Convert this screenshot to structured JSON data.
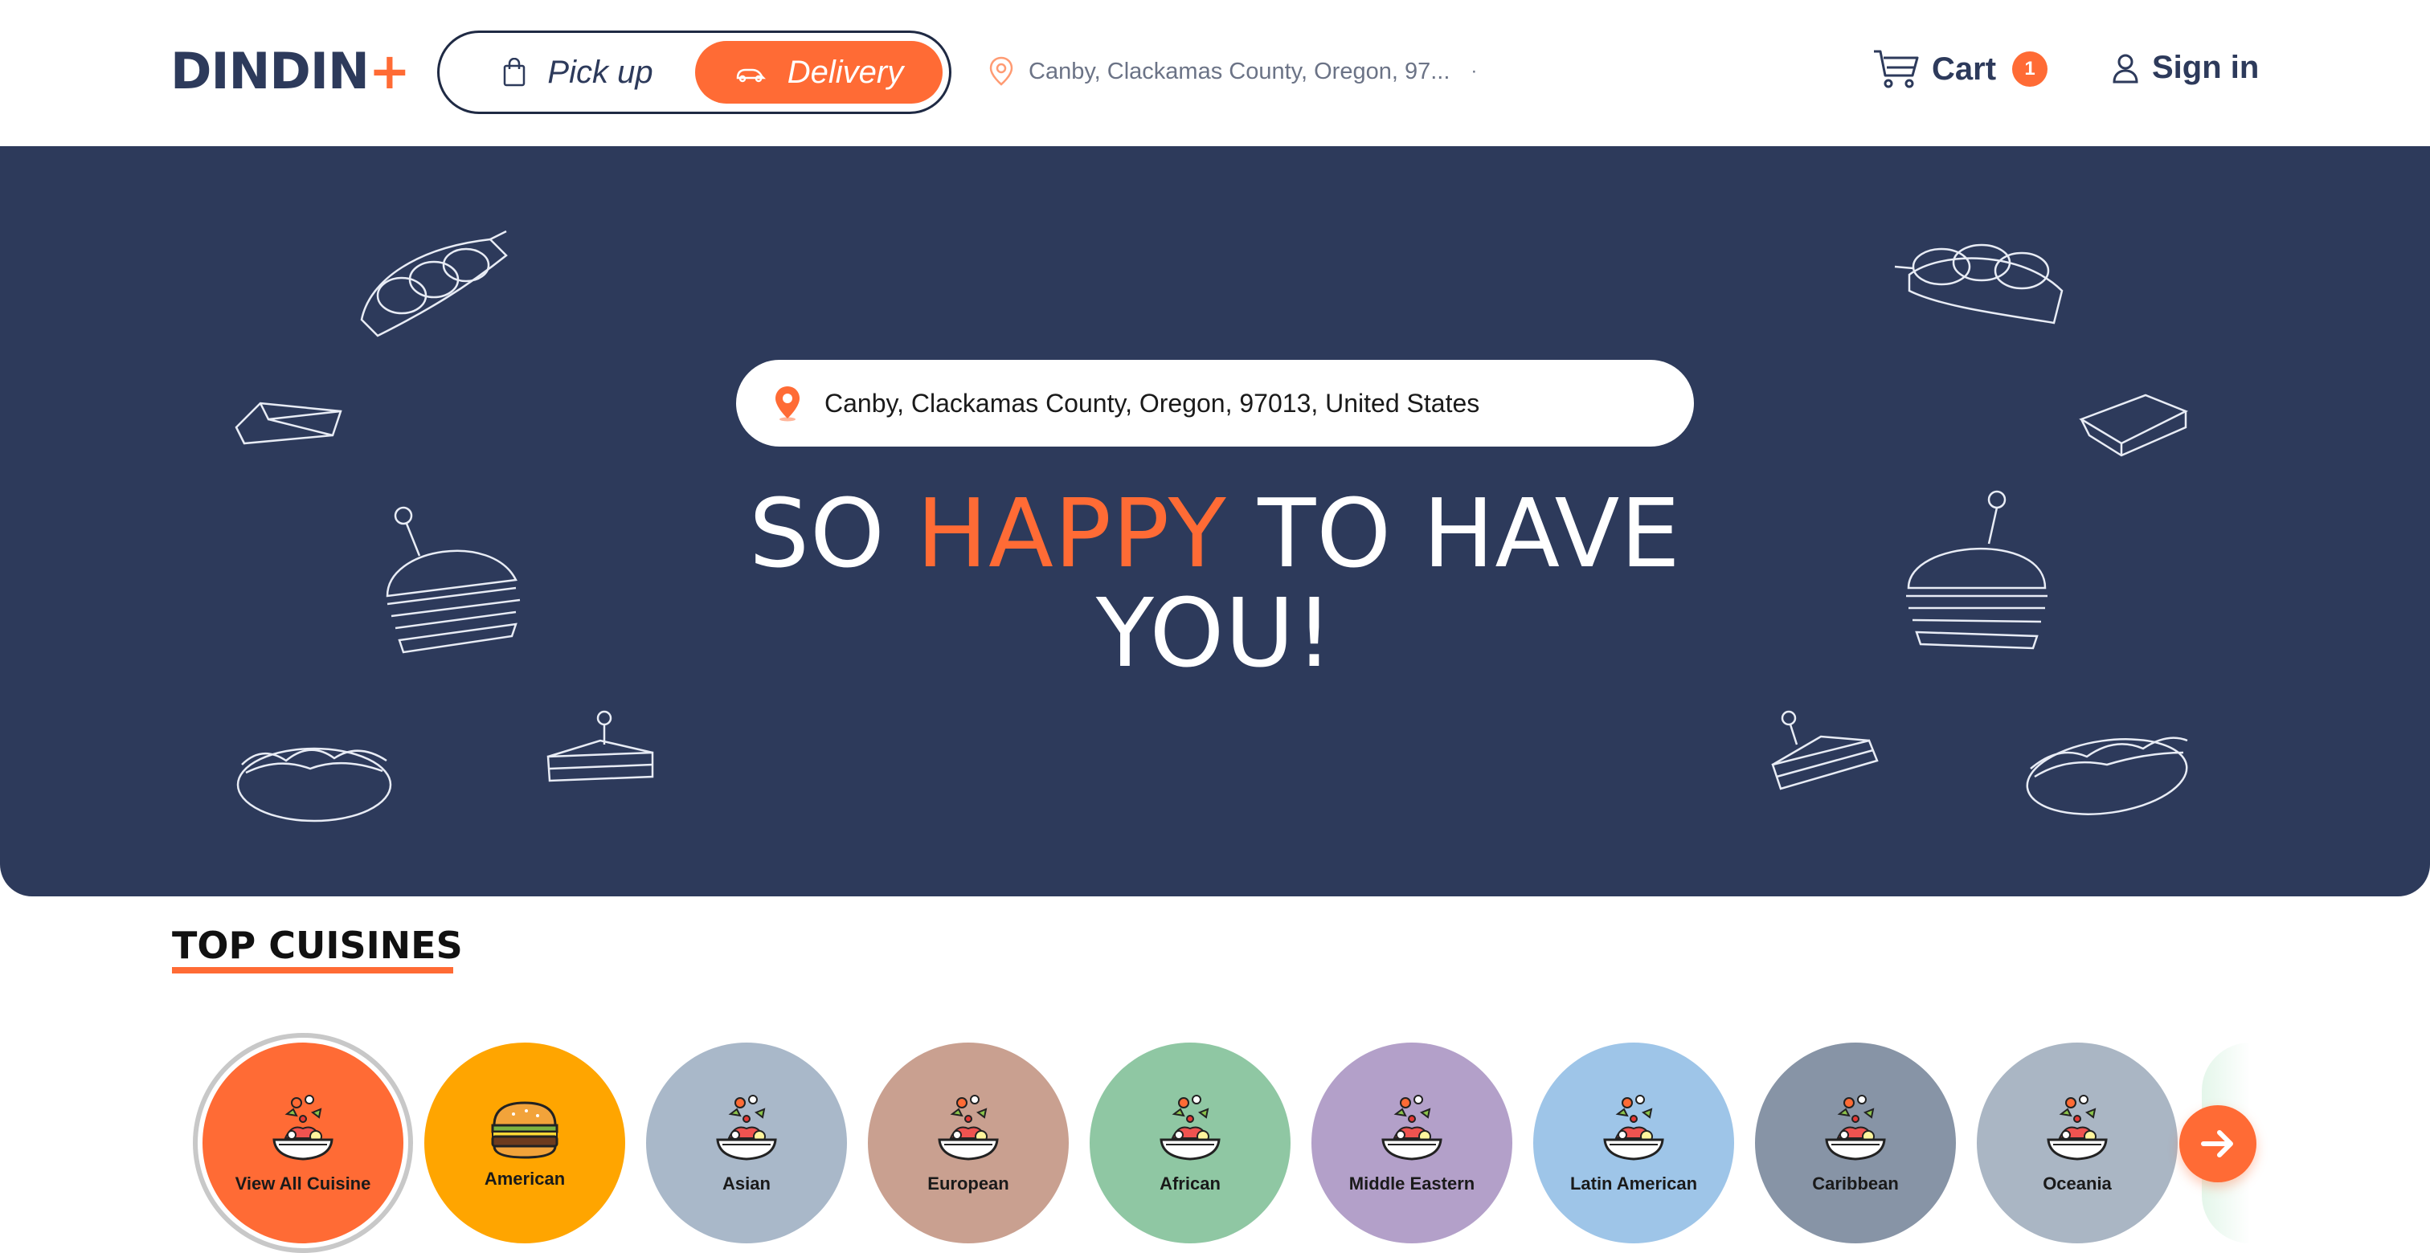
{
  "header": {
    "logo_text": "DINDIN",
    "logo_plus": "+",
    "mode_pickup": "Pick up",
    "mode_delivery": "Delivery",
    "location": "Canby, Clackamas County, Oregon, 97...",
    "location_dot": "·",
    "cart_label": "Cart",
    "cart_count": "1",
    "signin_label": "Sign in"
  },
  "hero": {
    "search_value": "Canby, Clackamas County, Oregon, 97013, United States",
    "title_part1": "SO ",
    "title_accent": "HAPPY",
    "title_part2": " TO HAVE",
    "title_line2": "YOU!"
  },
  "cuisines": {
    "title": "TOP CUISINES",
    "items": [
      {
        "label": "View All Cuisine",
        "color": "#ff6b35",
        "icon": "salad-bowl-icon",
        "selected": true
      },
      {
        "label": "American",
        "color": "#ffa500",
        "icon": "burger-icon"
      },
      {
        "label": "Asian",
        "color": "#a9b8c9",
        "icon": "salad-bowl-icon"
      },
      {
        "label": "European",
        "color": "#c9a090",
        "icon": "salad-bowl-icon"
      },
      {
        "label": "African",
        "color": "#8fc7a3",
        "icon": "salad-bowl-icon"
      },
      {
        "label": "Middle Eastern",
        "color": "#b3a0c9",
        "icon": "salad-bowl-icon"
      },
      {
        "label": "Latin American",
        "color": "#9ec5e8",
        "icon": "salad-bowl-icon"
      },
      {
        "label": "Caribbean",
        "color": "#8794a6",
        "icon": "salad-bowl-icon"
      },
      {
        "label": "Oceania",
        "color": "#aab6c4",
        "icon": "salad-bowl-icon"
      }
    ],
    "next_icon": "arrow-right-icon"
  },
  "colors": {
    "accent": "#ff6b35",
    "navy": "#2d3a5b"
  }
}
